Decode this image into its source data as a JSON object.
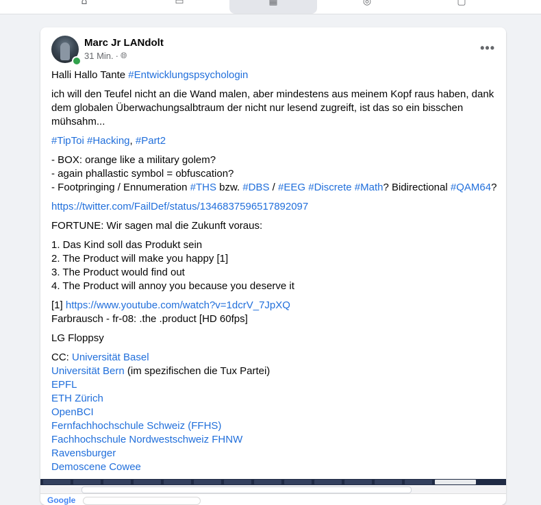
{
  "nav": {
    "tabs": [
      {
        "icon": "home-icon",
        "glyph": "⌂",
        "active": false
      },
      {
        "icon": "watch-icon",
        "glyph": "▭",
        "active": false
      },
      {
        "icon": "marketplace-icon",
        "glyph": "▦",
        "active": true
      },
      {
        "icon": "groups-icon",
        "glyph": "◎",
        "active": false
      },
      {
        "icon": "gaming-icon",
        "glyph": "▢",
        "active": false
      }
    ]
  },
  "post": {
    "author": "Marc Jr LANdolt",
    "time": "31 Min.",
    "separator": "·",
    "privacy_icon": "globe-icon",
    "more_label": "•••",
    "greeting": "Halli Hallo Tante ",
    "greeting_tag": "#Entwicklungspsychologin",
    "para1_l1": "ich will den Teufel nicht an die Wand malen, aber mindestens aus meinem Kopf raus haben, dank",
    "para1_l2": "dem globalen Überwachungsalbtraum der nicht nur lesend zugreift, ist das so ein bisschen",
    "para1_l3": "mühsahm...",
    "tag_tiptoi": "#TipToi",
    "tag_hacking": "#Hacking",
    "comma": ", ",
    "tag_part2": "#Part2",
    "box_l1": "- BOX: orange like a military golem?",
    "box_l2": "- again phallastic symbol = obfuscation?",
    "box_l3_a": "- Footpringing / Ennumeration ",
    "tag_ths": "#THS",
    "box_l3_b": " bzw. ",
    "tag_dbs": "#DBS",
    "box_l3_c": " / ",
    "tag_eeg": "#EEG",
    "space": " ",
    "tag_discrete": "#Discrete",
    "tag_math": "#Math",
    "box_l3_d": "? Bidirectional ",
    "tag_qam64": "#QAM64",
    "qmark": "?",
    "twitter_link": "https://twitter.com/FailDef/status/1346837596517892097",
    "fortune": "FORTUNE: Wir sagen mal die Zukunft voraus:",
    "list1": "1. Das Kind soll das Produkt sein",
    "list2": "2. The Product will make you happy [1]",
    "list3": "3. The Product would find out",
    "list4": "4. The Product will annoy you because you deserve it",
    "ref_prefix": "[1] ",
    "youtube_link": "https://www.youtube.com/watch?v=1dcrV_7JpXQ",
    "ref_title": "Farbrausch - fr-08: .the .product [HD 60fps]",
    "signature": "LG Floppsy",
    "cc_prefix": "CC: ",
    "cc_basel": "Universität Basel",
    "cc_bern": "Universität Bern",
    "cc_bern_note": " (im spezifischen die Tux Partei)",
    "cc_epfl": "EPFL",
    "cc_eth": "ETH Zürich",
    "cc_openbci": "OpenBCI",
    "cc_ffhs": "Fernfachhochschule Schweiz (FFHS)",
    "cc_fhnw": "Fachhochschule Nordwestschweiz FHNW",
    "cc_ravensburger": "Ravensburger",
    "cc_demoscene": "Demoscene Cowee"
  },
  "screenshot": {
    "google_text": "Google"
  },
  "colors": {
    "link": "#216fdb",
    "online": "#31a24c",
    "background": "#f0f2f5"
  }
}
